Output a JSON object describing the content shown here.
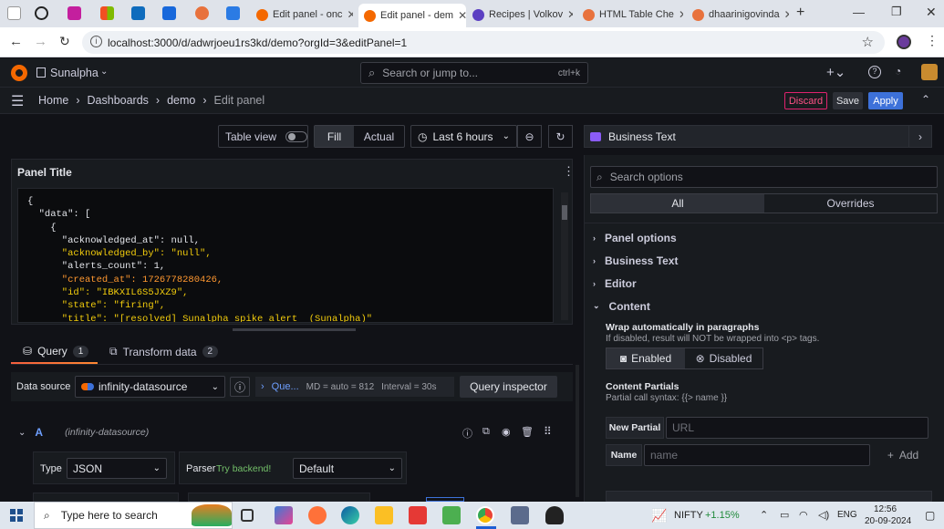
{
  "browser": {
    "tabs": [
      {
        "label": "Edit panel - onc",
        "active": false
      },
      {
        "label": "Edit panel - dem",
        "active": true
      },
      {
        "label": "Recipes | Volkov",
        "active": false
      },
      {
        "label": "HTML Table Che",
        "active": false
      },
      {
        "label": "dhaarinigovinda",
        "active": false
      }
    ],
    "url": "localhost:3000/d/adwrjoeu1rs3kd/demo?orgId=3&editPanel=1"
  },
  "grafana": {
    "org": "Sunalpha",
    "search_placeholder": "Search or jump to...",
    "search_shortcut": "ctrl+k",
    "breadcrumb": [
      "Home",
      "Dashboards",
      "demo",
      "Edit panel"
    ],
    "discard": "Discard",
    "save": "Save",
    "apply": "Apply"
  },
  "toolbar": {
    "table_view": "Table view",
    "fill": "Fill",
    "actual": "Actual",
    "time_range": "Last 6 hours"
  },
  "panel": {
    "title": "Panel Title",
    "code_lines": [
      "{",
      "  \"data\": [",
      "    {",
      "      \"acknowledged_at\": null,",
      "      \"acknowledged_by\": \"null\",",
      "      \"alerts_count\": 1,",
      "      \"created_at\": 1726778280426,",
      "      \"id\": \"IBKXIL6S5JXZ9\",",
      "      \"state\": \"firing\",",
      "      \"title\": \"[resolved] Sunalpha spike alert  (Sunalpha)\""
    ]
  },
  "query": {
    "tab_query": "Query",
    "tab_query_count": "1",
    "tab_transform": "Transform data",
    "tab_transform_count": "2",
    "data_source_label": "Data source",
    "data_source": "infinity-datasource",
    "queries_abbrev": "Que...",
    "md": "MD = auto = 812",
    "interval": "Interval = 30s",
    "inspector": "Query inspector",
    "row_letter": "A",
    "row_ds": "(infinity-datasource)",
    "type_label": "Type",
    "type_value": "JSON",
    "parser_label": "Parser",
    "try_backend": "Try backend!",
    "parser_value": "Default"
  },
  "options": {
    "viz": "Business Text",
    "search_placeholder": "Search options",
    "tab_all": "All",
    "tab_overrides": "Overrides",
    "sections": [
      "Panel options",
      "Business Text",
      "Editor",
      "Content"
    ],
    "wrap_title": "Wrap automatically in paragraphs",
    "wrap_desc": "If disabled, result will NOT be wrapped into <p> tags.",
    "enabled": "Enabled",
    "disabled": "Disabled",
    "partials_title": "Content Partials",
    "partials_desc": "Partial call syntax: {{> name }}",
    "new_partial": "New Partial",
    "url_placeholder": "URL",
    "name_label": "Name",
    "name_placeholder": "name",
    "add": "Add"
  },
  "taskbar": {
    "search": "Type here to search",
    "ticker": "NIFTY",
    "change": "+1.15%",
    "lang": "ENG",
    "time": "12:56",
    "date": "20-09-2024"
  }
}
